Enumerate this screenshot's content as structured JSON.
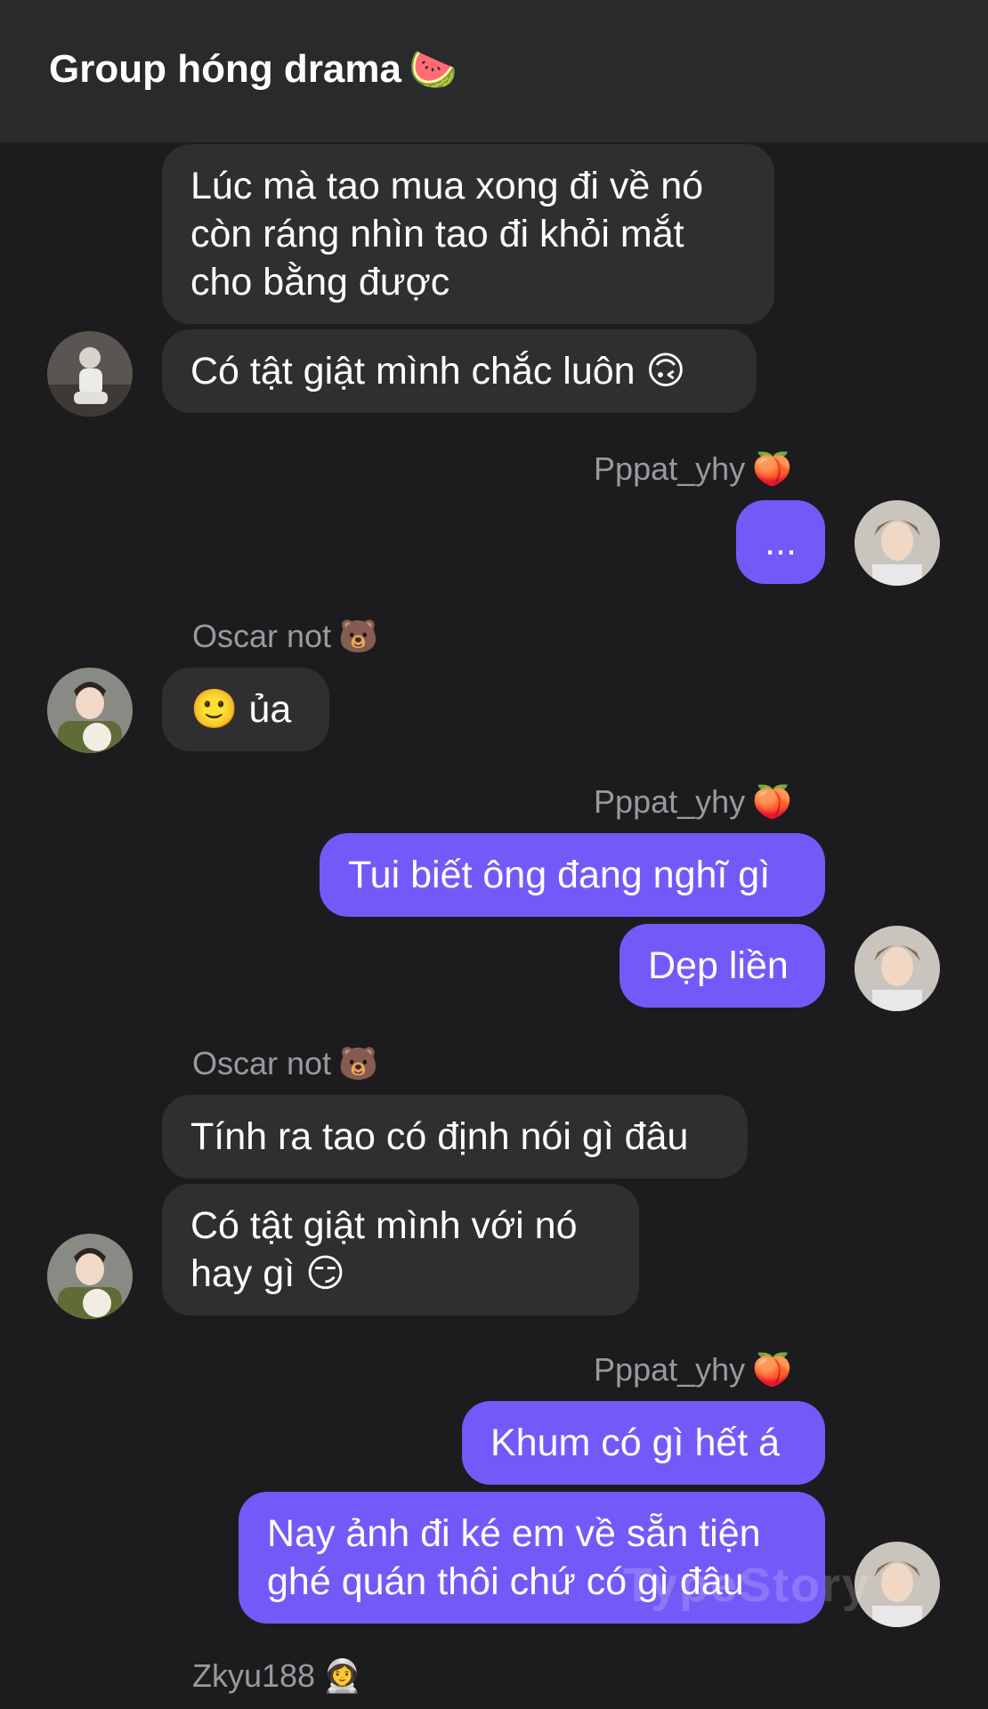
{
  "header": {
    "title": "Group hóng drama",
    "title_emoji": "🍉"
  },
  "messages": [
    {
      "text": "Lúc mà tao mua xong đi về nó còn ráng nhìn tao đi khỏi mắt cho bằng được"
    },
    {
      "text": "Có tật giật mình chắc luôn 🙃"
    },
    {
      "sender": "Pppat_yhy",
      "sender_emoji": "🍑",
      "text": "..."
    },
    {
      "sender": "Oscar not",
      "sender_emoji": "🐻",
      "text": "🙂  ủa"
    },
    {
      "sender": "Pppat_yhy",
      "sender_emoji": "🍑",
      "text": "Tui biết ông đang nghĩ gì"
    },
    {
      "text": "Dẹp liền"
    },
    {
      "sender": "Oscar not",
      "sender_emoji": "🐻",
      "text": "Tính ra tao có định nói gì đâu"
    },
    {
      "text": "Có tật giật mình với nó hay gì 😏"
    },
    {
      "sender": "Pppat_yhy",
      "sender_emoji": "🍑",
      "text": "Khum có gì hết á"
    },
    {
      "text": "Nay ảnh đi ké em về sẵn tiện ghé quán thôi chứ có gì đâu"
    },
    {
      "sender": "Zkyu188",
      "sender_emoji": "👩‍🚀"
    }
  ],
  "watermark": "TypeStory",
  "colors": {
    "outgoing": "#735af8",
    "incoming": "#2f2f31",
    "background": "#1c1c1e"
  }
}
